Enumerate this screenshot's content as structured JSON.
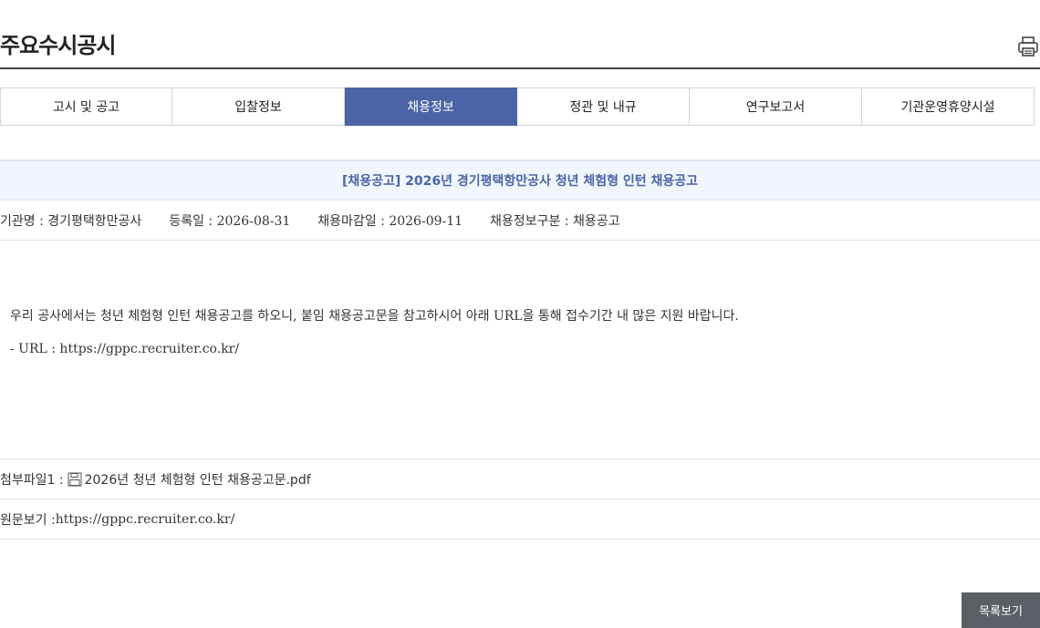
{
  "page": {
    "title": "주요수시공시"
  },
  "tabs": [
    {
      "label": "고시 및 공고"
    },
    {
      "label": "입찰정보"
    },
    {
      "label": "채용정보"
    },
    {
      "label": "정관 및 내규"
    },
    {
      "label": "연구보고서"
    },
    {
      "label": "기관운영휴양시설"
    }
  ],
  "post": {
    "title": "[채용공고] 2026년 경기평택항만공사 청년 체험형 인턴 채용공고",
    "meta": {
      "org_label": "기관명 : ",
      "org_value": "경기평택항만공사",
      "reg_label": "등록일 : ",
      "reg_value": "2026-08-31",
      "deadline_label": "채용마감일 : ",
      "deadline_value": "2026-09-11",
      "category_label": "채용정보구분 : ",
      "category_value": "채용공고"
    },
    "body": {
      "line1": "우리 공사에서는 청년 체험형 인턴 채용공고를 하오니, 붙임 채용공고문을 참고하시어 아래 URL을 통해 접수기간 내 많은 지원 바랍니다.",
      "line2": "- URL : https://gppc.recruiter.co.kr/"
    },
    "attachment": {
      "label": "첨부파일1 : ",
      "file_name": "2026년 청년 체험형 인턴 채용공고문.pdf"
    },
    "original": {
      "label": "원문보기 : ",
      "url": "https://gppc.recruiter.co.kr/"
    }
  },
  "buttons": {
    "list_label": "목록보기"
  },
  "colors": {
    "accent": "#4a64a6",
    "title_bar_bg": "#f1f6fc",
    "button_bg": "#5a5f66"
  },
  "icons": {
    "print": "printer-icon",
    "file": "floppy-disk-icon"
  }
}
